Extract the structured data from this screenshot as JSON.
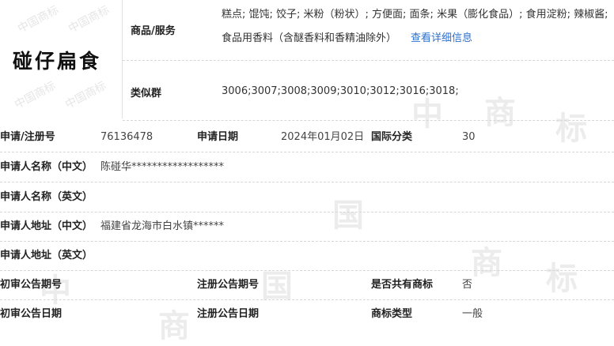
{
  "trademark": {
    "name": "碰仔扁食"
  },
  "goods": {
    "label": "商品/服务",
    "line1": "糕点; 馄饨; 饺子; 米粉（粉状）; 方便面; 面条; 米果（膨化食品）; 食用淀粉; 辣椒酱;",
    "line2": "食品用香料（含醚香料和香精油除外）",
    "more_link": "查看详细信息"
  },
  "similar_group": {
    "label": "类似群",
    "value": "3006;3007;3008;3009;3010;3012;3016;3018;"
  },
  "fields": {
    "reg_no_label": "申请/注册号",
    "reg_no": "76136478",
    "apply_date_label": "申请日期",
    "apply_date": "2024年01月02日",
    "intl_class_label": "国际分类",
    "intl_class": "30",
    "applicant_cn_label": "申请人名称（中文）",
    "applicant_cn": "陈碰华******************",
    "applicant_en_label": "申请人名称（英文）",
    "address_cn_label": "申请人地址（中文）",
    "address_cn": "福建省龙海市白水镇******",
    "address_en_label": "申请人地址（英文）",
    "prelim_no_label": "初审公告期号",
    "reg_notice_no_label": "注册公告期号",
    "shared_label": "是否共有商标",
    "shared": "否",
    "prelim_date_label": "初审公告日期",
    "reg_notice_date_label": "注册公告日期",
    "mark_type_label": "商标类型",
    "mark_type": "一般"
  }
}
